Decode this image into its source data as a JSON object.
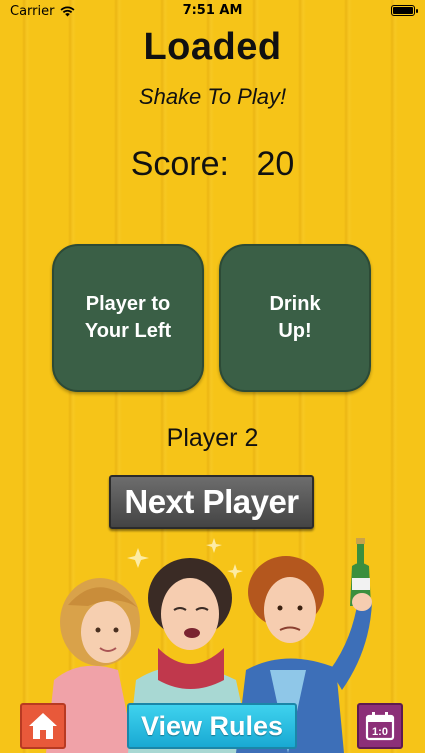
{
  "status_bar": {
    "carrier": "Carrier",
    "time": "7:51 AM"
  },
  "header": {
    "title": "Loaded",
    "subtitle": "Shake To Play!"
  },
  "score": {
    "label": "Score:",
    "value": "20"
  },
  "cards": [
    {
      "line1": "Player to",
      "line2": "Your Left"
    },
    {
      "line1": "Drink",
      "line2": "Up!"
    }
  ],
  "current_player": "Player 2",
  "buttons": {
    "next_player": "Next Player",
    "view_rules": "View Rules",
    "calendar_icon_text": "1:0"
  },
  "colors": {
    "background": "#f6c418",
    "card": "#3a5f46",
    "next_button": "#555555",
    "home_button": "#e8593a",
    "rules_button": "#2bbfe2",
    "calendar_button": "#8c2f78"
  },
  "icons": [
    "wifi-icon",
    "battery-icon",
    "home-icon",
    "calendar-icon",
    "bottle-icon"
  ]
}
